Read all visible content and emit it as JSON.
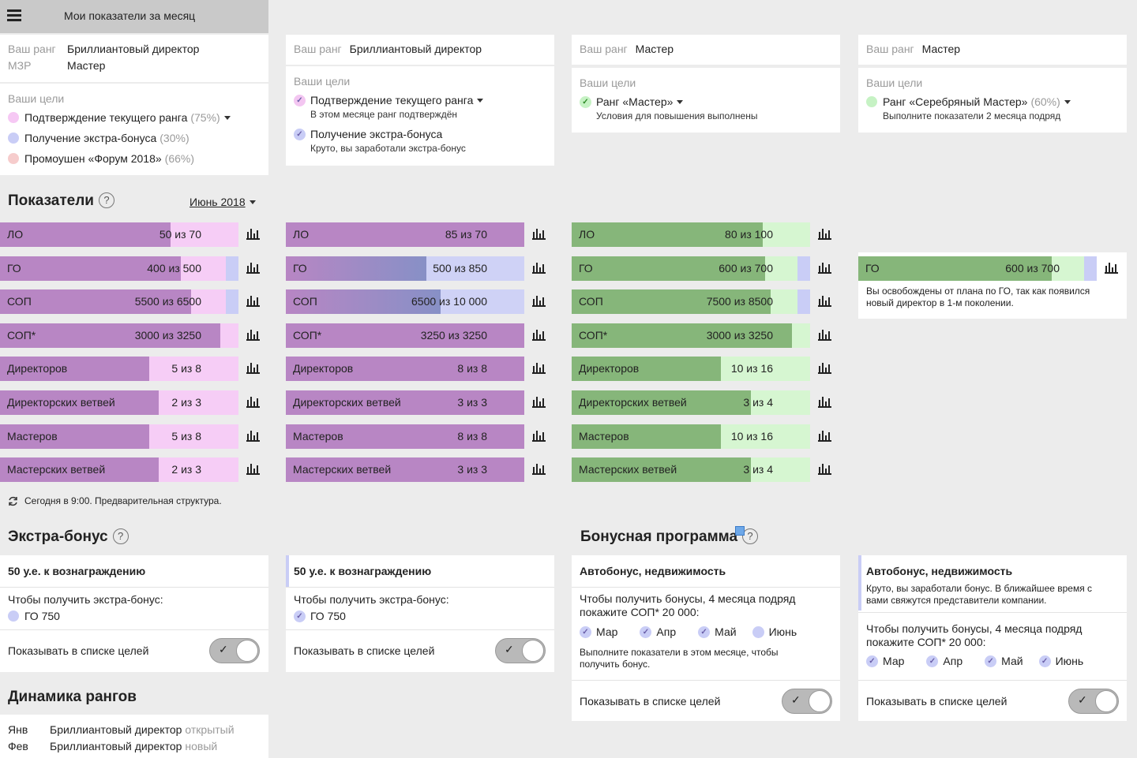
{
  "header": {
    "title": "Мои показатели за месяц"
  },
  "labels": {
    "your_rank": "Ваш ранг",
    "mzr": "МЗР",
    "your_goals": "Ваши цели",
    "to_get_bonus": "Чтобы получить экстра-бонус:",
    "show_in_goals": "Показывать в списке целей"
  },
  "col1": {
    "rank": "Бриллиантовый директор",
    "mzr": "Мастер",
    "goals": [
      {
        "text": "Подтверждение текущего ранга",
        "pct": "(75%)",
        "color": "#f6c8f4"
      },
      {
        "text": "Получение экстра-бонуса",
        "pct": "(30%)",
        "color": "#c9cdf6"
      },
      {
        "text": "Промоушен «Форум 2018»",
        "pct": "(66%)",
        "color": "#f6cccc"
      }
    ]
  },
  "col2": {
    "rank": "Бриллиантовый директор",
    "goals": [
      {
        "text": "Подтверждение текущего ранга",
        "sub": "В этом месяце ранг подтверждён",
        "color": "#f3c6f1"
      },
      {
        "text": "Получение экстра-бонуса",
        "sub": "Круто, вы заработали экстра-бонус",
        "color": "#c9cdf6"
      }
    ]
  },
  "col3": {
    "rank": "Мастер",
    "goals": [
      {
        "text": "Ранг «Мастер»",
        "sub": "Условия для повышения выполнены",
        "color": "#c6f2c4"
      }
    ]
  },
  "col4": {
    "rank": "Мастер",
    "goals": [
      {
        "text": "Ранг «Серебряный Мастер»",
        "pct": "(60%)",
        "sub": "Выполните показатели 2 месяца подряд",
        "color": "#c6f2c4"
      }
    ]
  },
  "sections": {
    "metrics": "Показатели",
    "extra_bonus": "Экстра-бонус",
    "bonus_program": "Бонусная программа",
    "rank_dynamics": "Динамика рангов"
  },
  "period": "Июнь 2018",
  "metrics": {
    "col1": [
      {
        "label": "ЛО",
        "value": "50 из 70",
        "progress": 0.714,
        "extra": 0
      },
      {
        "label": "ГО",
        "value": "400 из 500",
        "progress": 0.8,
        "extra": 0.18
      },
      {
        "label": "СОП",
        "value": "5500 из 6500",
        "progress": 0.846,
        "extra": 0.18
      },
      {
        "label": "СОП*",
        "value": "3000 из 3250",
        "progress": 0.923,
        "extra": 0
      },
      {
        "label": "Директоров",
        "value": "5 из 8",
        "progress": 0.625,
        "extra": 0
      },
      {
        "label": "Директорских ветвей",
        "value": "2 из 3",
        "progress": 0.667,
        "extra": 0
      },
      {
        "label": "Мастеров",
        "value": "5 из 8",
        "progress": 0.625,
        "extra": 0
      },
      {
        "label": "Мастерских ветвей",
        "value": "2 из 3",
        "progress": 0.667,
        "extra": 0
      }
    ],
    "col2": [
      {
        "label": "ЛО",
        "value": "85 из 70",
        "progress": 1.0
      },
      {
        "label": "ГО",
        "value": "500 из 850",
        "progress": 0.588
      },
      {
        "label": "СОП",
        "value": "6500 из 10 000",
        "progress": 0.65
      },
      {
        "label": "СОП*",
        "value": "3250 из 3250",
        "progress": 1.0
      },
      {
        "label": "Директоров",
        "value": "8 из 8",
        "progress": 1.0
      },
      {
        "label": "Директорских ветвей",
        "value": "3 из 3",
        "progress": 1.0
      },
      {
        "label": "Мастеров",
        "value": "8 из 8",
        "progress": 1.0
      },
      {
        "label": "Мастерских ветвей",
        "value": "3 из 3",
        "progress": 1.0
      }
    ],
    "col3": [
      {
        "label": "ЛО",
        "value": "80 из 100",
        "progress": 0.8,
        "extra": 0
      },
      {
        "label": "ГО",
        "value": "600 из 700",
        "progress": 0.857,
        "extra": 0.14
      },
      {
        "label": "СОП",
        "value": "7500 из 8500",
        "progress": 0.882,
        "extra": 0.14
      },
      {
        "label": "СОП*",
        "value": "3000 из 3250",
        "progress": 0.923,
        "extra": 0
      },
      {
        "label": "Директоров",
        "value": "10 из 16",
        "progress": 0.625,
        "extra": 0
      },
      {
        "label": "Директорских ветвей",
        "value": "3 из 4",
        "progress": 0.75,
        "extra": 0
      },
      {
        "label": "Мастеров",
        "value": "10 из 16",
        "progress": 0.625,
        "extra": 0
      },
      {
        "label": "Мастерских ветвей",
        "value": "3 из 4",
        "progress": 0.75,
        "extra": 0
      }
    ],
    "col4": [
      {
        "label": "ГО",
        "value": "600 из 700",
        "progress": 0.857,
        "extra": 0.14
      }
    ],
    "col4_note": "Вы освобождены от плана по ГО, так как появился новый директор в 1-м поколении."
  },
  "refresh_note": "Сегодня в 9:00. Предварительная структура.",
  "extra_bonus": {
    "col1": {
      "reward": "50 у.е. к вознаграждению",
      "goal": "ГО 750",
      "checked": false
    },
    "col2": {
      "reward": "50 у.е. к вознаграждению",
      "goal": "ГО 750",
      "checked": true
    }
  },
  "bonus_program": {
    "col3": {
      "title": "Автобонус, недвижимость",
      "desc": "Чтобы получить бонусы, 4 месяца подряд покажите СОП* 20 000:",
      "months": [
        {
          "name": "Мар",
          "checked": true
        },
        {
          "name": "Апр",
          "checked": true
        },
        {
          "name": "Май",
          "checked": true
        },
        {
          "name": "Июнь",
          "checked": false
        }
      ],
      "note": "Выполните показатели в этом месяце, чтобы получить бонус."
    },
    "col4": {
      "title": "Автобонус, недвижимость",
      "success": "Круто, вы заработали бонус. В ближайшее время с вами свяжутся представители компании.",
      "desc": "Чтобы получить бонусы, 4 месяца подряд покажите СОП* 20 000:",
      "months": [
        {
          "name": "Мар",
          "checked": true
        },
        {
          "name": "Апр",
          "checked": true
        },
        {
          "name": "Май",
          "checked": true
        },
        {
          "name": "Июнь",
          "checked": true
        }
      ]
    }
  },
  "rank_dynamics": [
    {
      "month": "Янв",
      "rank": "Бриллиантовый директор",
      "status": "открытый"
    },
    {
      "month": "Фев",
      "rank": "Бриллиантовый директор",
      "status": "новый"
    }
  ],
  "colors": {
    "purple_fill": "#b886c4",
    "purple_track": "#f6cdf6",
    "extra_blue": "#c9cdf6",
    "blue_fill": "#8790c6",
    "blue_track": "#cfd2f6",
    "green_fill": "#86b67a",
    "green_track": "#d6f6d1",
    "check_purple": "#9a78d8",
    "check_green": "#5cbc4d"
  },
  "icons": {
    "menu": "hamburger-icon",
    "chart": "bar-chart-icon",
    "refresh": "refresh-icon",
    "help": "help-icon"
  }
}
